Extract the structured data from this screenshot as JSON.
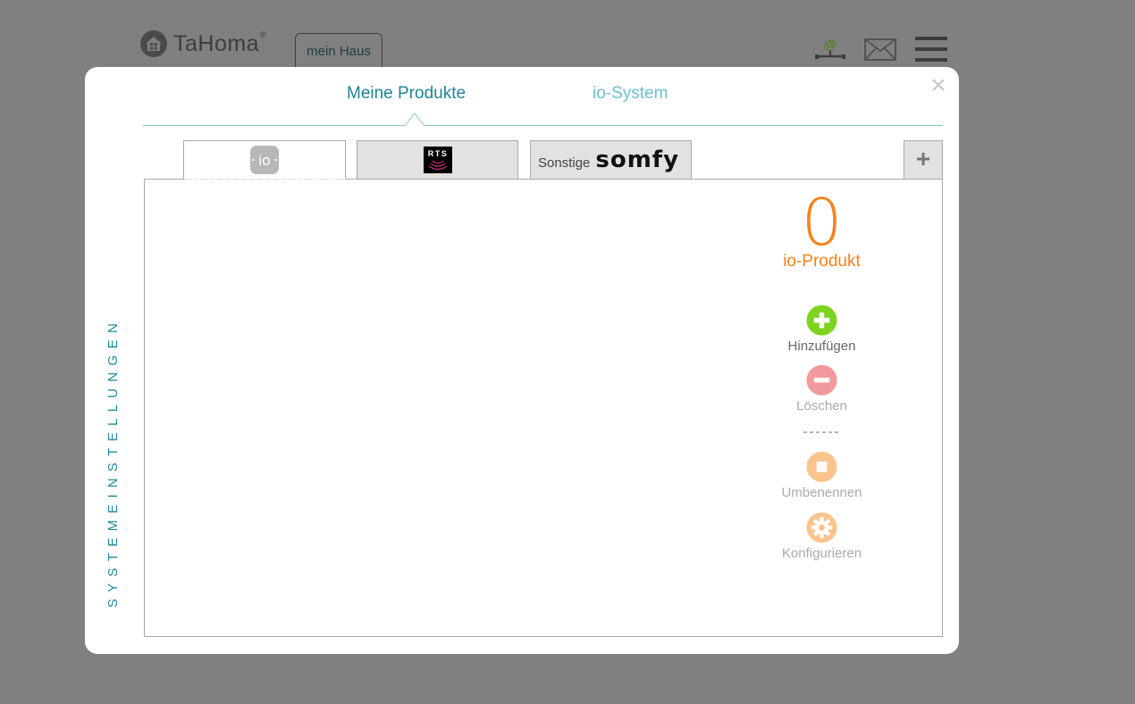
{
  "app": {
    "logo_text": "TaHoma",
    "logo_mark": "®",
    "home_tab_label": "mein Haus"
  },
  "modal": {
    "side_title": "SYSTEMEINSTELLUNGEN",
    "close_symbol": "×",
    "tabs": [
      {
        "label": "Meine Produkte",
        "active": true
      },
      {
        "label": "io-System",
        "active": false
      }
    ],
    "sub_tabs": [
      {
        "id": "io",
        "label": "io",
        "active": true
      },
      {
        "id": "rts",
        "label": "RTS",
        "active": false
      },
      {
        "id": "sonstige",
        "label": "Sonstige",
        "brand": "somfy",
        "active": false
      }
    ],
    "add_tab_symbol": "+",
    "product_count": "0",
    "product_count_label": "io-Produkt",
    "actions": [
      {
        "label": "Hinzufügen",
        "icon": "plus-circle-icon",
        "color": "#7ed321",
        "enabled": true
      },
      {
        "label": "Löschen",
        "icon": "minus-circle-icon",
        "color": "#f1999b",
        "enabled": false
      },
      {
        "label": "Umbenennen",
        "icon": "rename-icon",
        "color": "#fbc48c",
        "enabled": false
      },
      {
        "label": "Konfigurieren",
        "icon": "gear-icon",
        "color": "#fbc48c",
        "enabled": false
      }
    ],
    "separator": "------"
  },
  "colors": {
    "accent": "#1c8595",
    "accent_light": "#6cc1cc",
    "count": "#f7821b",
    "overlay": "#808080"
  }
}
